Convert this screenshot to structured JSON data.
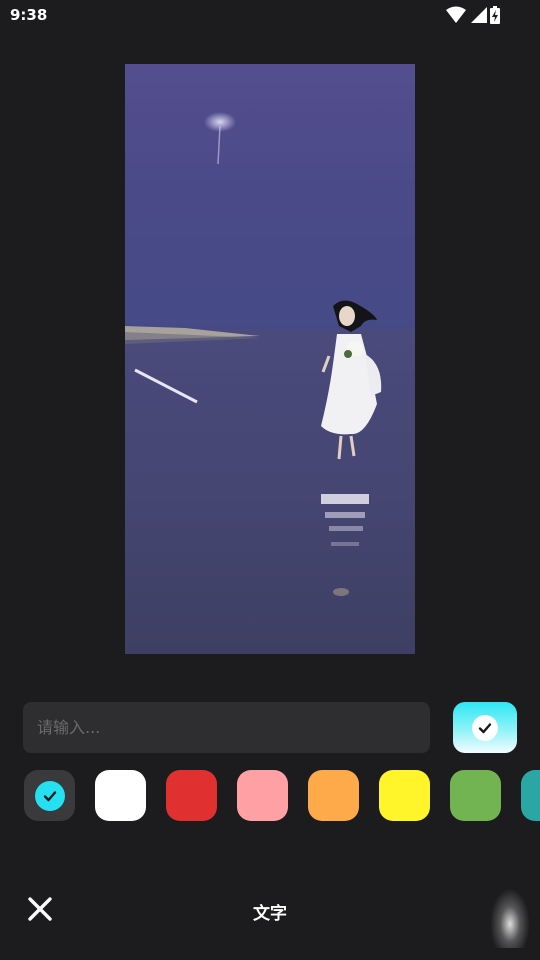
{
  "status_bar": {
    "time": "9:38",
    "icons": [
      "wifi-icon",
      "signal-icon",
      "battery-charging-icon"
    ]
  },
  "preview": {
    "description_icon": "photo-preview"
  },
  "text_input": {
    "placeholder": "请输入...",
    "value": ""
  },
  "confirm_button": {
    "icon": "check-icon",
    "gradient": [
      "#2ee6f4",
      "#f4fbff"
    ]
  },
  "palette": {
    "selected_index": 0,
    "colors": [
      {
        "name": "cyan",
        "hex": "#24e0f0"
      },
      {
        "name": "white",
        "hex": "#ffffff"
      },
      {
        "name": "red",
        "hex": "#e03030"
      },
      {
        "name": "pink",
        "hex": "#ffa0a4"
      },
      {
        "name": "orange",
        "hex": "#ffaa4a"
      },
      {
        "name": "yellow",
        "hex": "#fff52a"
      },
      {
        "name": "green",
        "hex": "#72b452"
      },
      {
        "name": "teal",
        "hex": "#2aa6a4"
      }
    ]
  },
  "bottom_bar": {
    "title": "文字",
    "close_icon": "close-icon"
  }
}
